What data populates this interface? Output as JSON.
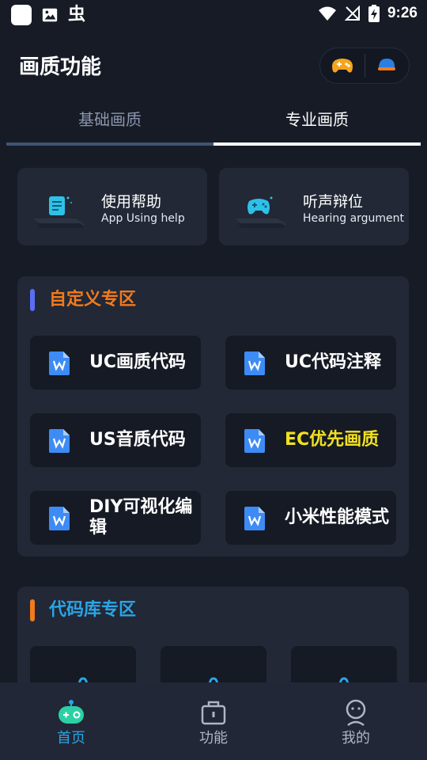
{
  "status_bar": {
    "time": "9:26",
    "notification_glyph": "虫"
  },
  "header": {
    "title": "基础画质"
  },
  "header_title": "画质功能",
  "tabs": [
    {
      "label": "基础画质",
      "active": false
    },
    {
      "label": "专业画质",
      "active": true
    }
  ],
  "help_cards": [
    {
      "title": "使用帮助",
      "subtitle": "App Using help",
      "icon": "document-icon"
    },
    {
      "title": "听声辩位",
      "subtitle": "Hearing argument",
      "icon": "gamepad-icon"
    }
  ],
  "sections": [
    {
      "title": "自定义专区",
      "title_color": "#f27a1b",
      "bar_color": "#5b6df5",
      "items": [
        {
          "label": "UC画质代码"
        },
        {
          "label": "UC代码注释"
        },
        {
          "label": "US音质代码"
        },
        {
          "label": "EC优先画质",
          "highlight": true
        },
        {
          "label": "DIY可视化编辑"
        },
        {
          "label": "小米性能模式"
        }
      ]
    },
    {
      "title": "代码库专区",
      "title_color": "#2aa5e6",
      "bar_color": "#f27a1b"
    }
  ],
  "bottom_nav": [
    {
      "label": "首页",
      "icon": "robot-icon",
      "active": true
    },
    {
      "label": "功能",
      "icon": "toolbox-icon",
      "active": false
    },
    {
      "label": "我的",
      "icon": "person-icon",
      "active": false
    }
  ],
  "colors": {
    "background": "#161b26",
    "card": "#222836",
    "accent_blue": "#2aa5e6",
    "accent_orange": "#f27a1b",
    "highlight_yellow": "#f2e11f"
  }
}
